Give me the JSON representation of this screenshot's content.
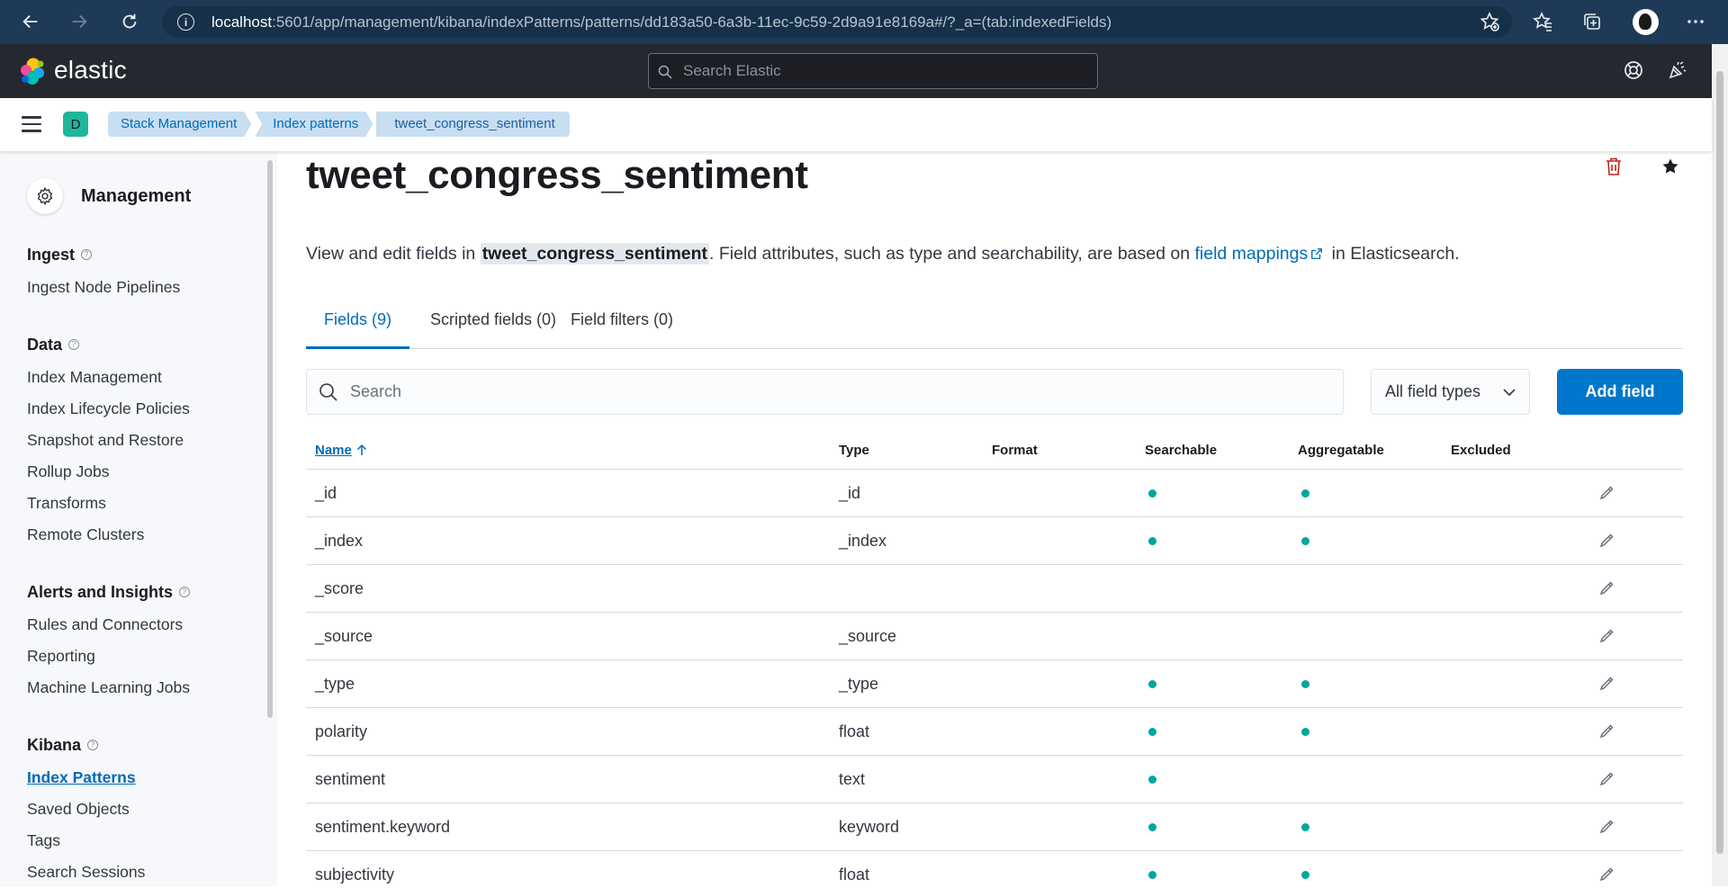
{
  "browser": {
    "url_host": "localhost",
    "url_rest": ":5601/app/management/kibana/indexPatterns/patterns/dd183a50-6a3b-11ec-9c59-2d9a91e8169a#/?_a=(tab:indexedFields)",
    "info_glyph": "i"
  },
  "header": {
    "logo_text": "elastic",
    "search_placeholder": "Search Elastic"
  },
  "breadcrumbs": {
    "space_initial": "D",
    "items": [
      "Stack Management",
      "Index patterns",
      "tweet_congress_sentiment"
    ]
  },
  "sidebar": {
    "title": "Management",
    "help_glyph": "?",
    "sections": [
      {
        "title": "Ingest",
        "items": [
          "Ingest Node Pipelines"
        ]
      },
      {
        "title": "Data",
        "items": [
          "Index Management",
          "Index Lifecycle Policies",
          "Snapshot and Restore",
          "Rollup Jobs",
          "Transforms",
          "Remote Clusters"
        ]
      },
      {
        "title": "Alerts and Insights",
        "items": [
          "Rules and Connectors",
          "Reporting",
          "Machine Learning Jobs"
        ]
      },
      {
        "title": "Kibana",
        "items": [
          "Index Patterns",
          "Saved Objects",
          "Tags",
          "Search Sessions"
        ]
      }
    ],
    "active_item": "Index Patterns"
  },
  "main": {
    "title": "tweet_congress_sentiment",
    "description": {
      "prefix": "View and edit fields in ",
      "highlight": "tweet_congress_sentiment",
      "middle": ". Field attributes, such as type and searchability, are based on ",
      "link": "field mappings",
      "suffix": " in Elasticsearch."
    },
    "tabs": [
      "Fields (9)",
      "Scripted fields (0)",
      "Field filters (0)"
    ],
    "selected_tab": 0,
    "search_placeholder": "Search",
    "type_filter": "All field types",
    "add_button": "Add field"
  },
  "table": {
    "columns": [
      "Name",
      "Type",
      "Format",
      "Searchable",
      "Aggregatable",
      "Excluded"
    ],
    "sorted_column": "Name",
    "rows": [
      {
        "name": "_id",
        "type": "_id",
        "format": "",
        "searchable": true,
        "aggregatable": true,
        "excluded": false
      },
      {
        "name": "_index",
        "type": "_index",
        "format": "",
        "searchable": true,
        "aggregatable": true,
        "excluded": false
      },
      {
        "name": "_score",
        "type": "",
        "format": "",
        "searchable": false,
        "aggregatable": false,
        "excluded": false
      },
      {
        "name": "_source",
        "type": "_source",
        "format": "",
        "searchable": false,
        "aggregatable": false,
        "excluded": false
      },
      {
        "name": "_type",
        "type": "_type",
        "format": "",
        "searchable": true,
        "aggregatable": true,
        "excluded": false
      },
      {
        "name": "polarity",
        "type": "float",
        "format": "",
        "searchable": true,
        "aggregatable": true,
        "excluded": false
      },
      {
        "name": "sentiment",
        "type": "text",
        "format": "",
        "searchable": true,
        "aggregatable": false,
        "excluded": false
      },
      {
        "name": "sentiment.keyword",
        "type": "keyword",
        "format": "",
        "searchable": true,
        "aggregatable": true,
        "excluded": false
      },
      {
        "name": "subjectivity",
        "type": "float",
        "format": "",
        "searchable": true,
        "aggregatable": true,
        "excluded": false
      }
    ]
  },
  "colors": {
    "accent": "#0077cc",
    "link": "#006bb8",
    "status_dot": "#00a69b",
    "danger": "#bd271e",
    "header_bg": "#25282f",
    "browser_bg": "#1f3a56"
  },
  "icons": {
    "browser": [
      "back-icon",
      "forward-icon",
      "refresh-icon",
      "info-icon",
      "favorite-add-icon",
      "favorites-icon",
      "collections-icon",
      "profile-avatar",
      "more-icon"
    ],
    "header": [
      "search-icon",
      "help-icon",
      "newsfeed-icon"
    ],
    "page": [
      "delete-icon",
      "favorite-star-icon",
      "external-link-icon",
      "sort-ascending-icon",
      "pencil-edit-icon",
      "chevron-down-icon"
    ]
  }
}
